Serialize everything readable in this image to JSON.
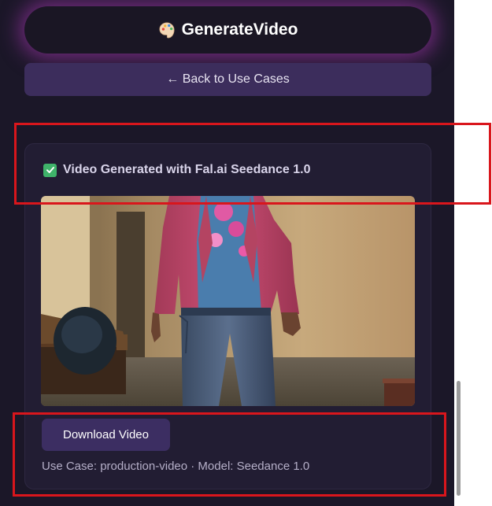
{
  "header": {
    "title_part1": "Generate",
    "title_part2": "Video",
    "icon": "palette-icon"
  },
  "nav": {
    "back_label": "← Back to Use Cases"
  },
  "result": {
    "status_icon": "checkmark-icon",
    "status_text": "Video Generated with Fal.ai Seedance 1.0",
    "download_label": "Download Video",
    "meta": "Use Case: production-video · Model: Seedance 1.0"
  },
  "colors": {
    "panel_bg": "#1b1728",
    "header_glow": "#be3cc8",
    "button_bg": "#3c2e62",
    "status_check": "#3fb36a",
    "annotation": "#d9161c"
  }
}
